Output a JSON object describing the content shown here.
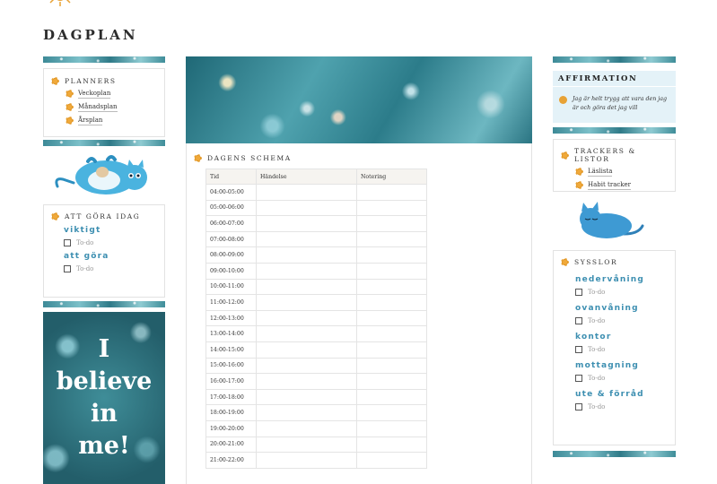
{
  "page": {
    "title": "DAGPLAN"
  },
  "planners": {
    "heading": "PLANNERS",
    "items": [
      {
        "label": "Veckoplan"
      },
      {
        "label": "Månadsplan"
      },
      {
        "label": "Årsplan"
      }
    ]
  },
  "todo": {
    "heading": "ATT GÖRA IDAG",
    "groups": [
      {
        "label": "viktigt",
        "item": "To-do"
      },
      {
        "label": "att göra",
        "item": "To-do"
      }
    ]
  },
  "poster": {
    "text": "I\nbelieve\nin\nme!"
  },
  "schedule": {
    "heading": "DAGENS SCHEMA",
    "columns": [
      "Tid",
      "Händelse",
      "Notering"
    ],
    "rows": [
      "04:00-05:00",
      "05:00-06:00",
      "06:00-07:00",
      "07:00-08:00",
      "08:00-09:00",
      "09:00-10:00",
      "10:00-11:00",
      "11:00-12:00",
      "12:00-13:00",
      "13:00-14:00",
      "14:00-15:00",
      "15:00-16:00",
      "16:00-17:00",
      "17:00-18:00",
      "18:00-19:00",
      "19:00-20:00",
      "20:00-21:00",
      "21:00-22:00"
    ]
  },
  "affirmation": {
    "heading": "AFFIRMATION",
    "text": "Jag är helt trygg att vara den jag är och göra det jag vill"
  },
  "trackers": {
    "heading": "TRACKERS & LISTOR",
    "items": [
      {
        "label": "Läslista"
      },
      {
        "label": "Habit tracker"
      }
    ]
  },
  "chores": {
    "heading": "SYSSLOR",
    "groups": [
      {
        "label": "nedervåning",
        "item": "To-do"
      },
      {
        "label": "ovanvåning",
        "item": "To-do"
      },
      {
        "label": "kontor",
        "item": "To-do"
      },
      {
        "label": "mottagning",
        "item": "To-do"
      },
      {
        "label": "ute & förråd",
        "item": "To-do"
      }
    ]
  },
  "colors": {
    "accent": "#3d8fb1",
    "icon": "#e8a235",
    "teal": "#3f8d98",
    "affirmation_bg": "#e4f2f8"
  }
}
